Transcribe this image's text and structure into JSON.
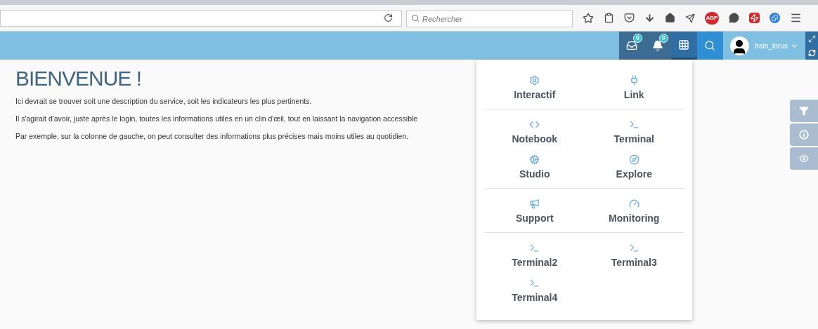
{
  "browser_toolbar": {
    "search": {
      "placeholder": "Rechercher"
    },
    "adblock_badge": "ABP"
  },
  "header": {
    "buttons": [
      {
        "kind": "messages",
        "badge": "0",
        "selected": false
      },
      {
        "kind": "bell",
        "badge": "0",
        "selected": false
      },
      {
        "kind": "apps",
        "selected": true
      },
      {
        "kind": "search",
        "selected": false
      }
    ],
    "user": "train_torus"
  },
  "page": {
    "title": "BIENVENUE !",
    "paragraphs": [
      "Ici devrait se trouver soit une description du service, soit les indicateurs les plus pertinents.",
      "Il s'agirait d'avoir, juste après le login, toutes les informations utiles en un clin d'œil, tout en laissant la navigation accessible",
      "Par exemple, sur la colonne de gauche, on peut consulter des informations plus précises mais moins utiles au quotidien."
    ]
  },
  "apps_menu": {
    "sections": [
      [
        {
          "label": "Interactif",
          "kind": "gear"
        },
        {
          "label": "Link",
          "kind": "plug"
        }
      ],
      [
        {
          "label": "Notebook",
          "kind": "code"
        },
        {
          "label": "Terminal",
          "kind": "prompt"
        },
        {
          "label": "Studio",
          "kind": "gears"
        },
        {
          "label": "Explore",
          "kind": "compass"
        }
      ],
      [
        {
          "label": "Support",
          "kind": "megaphone"
        },
        {
          "label": "Monitoring",
          "kind": "gauge"
        }
      ],
      [
        {
          "label": "Terminal2",
          "kind": "prompt"
        },
        {
          "label": "Terminal3",
          "kind": "prompt"
        },
        {
          "label": "Terminal4",
          "kind": "prompt"
        }
      ]
    ]
  },
  "side_tabs": [
    {
      "kind": "filter"
    },
    {
      "kind": "info"
    },
    {
      "kind": "eye"
    }
  ]
}
